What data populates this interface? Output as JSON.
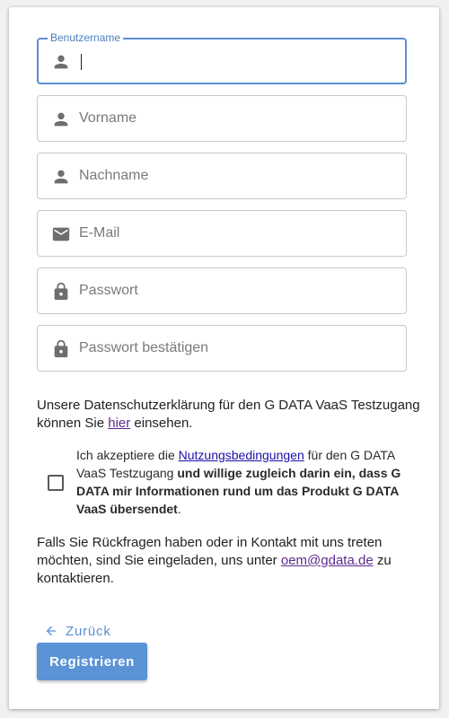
{
  "form": {
    "fields": [
      {
        "name": "username",
        "label": "Benutzername",
        "value": "",
        "placeholder": "",
        "icon": "person-icon",
        "focused": true
      },
      {
        "name": "firstname",
        "placeholder": "Vorname",
        "icon": "person-icon"
      },
      {
        "name": "lastname",
        "placeholder": "Nachname",
        "icon": "person-icon"
      },
      {
        "name": "email",
        "placeholder": "E-Mail",
        "icon": "mail-icon"
      },
      {
        "name": "password",
        "placeholder": "Passwort",
        "icon": "lock-icon"
      },
      {
        "name": "password-confirm",
        "placeholder": "Passwort bestätigen",
        "icon": "lock-icon"
      }
    ]
  },
  "privacy": {
    "text_before": "Unsere Datenschutzerklärung für den G DATA VaaS Testzugang können Sie ",
    "link": "hier",
    "text_after": " einsehen."
  },
  "consent": {
    "checked": false,
    "text_before": "Ich akzeptiere die ",
    "link": "Nutzungsbedingungen",
    "text_mid": " für den G DATA VaaS Testzugang ",
    "text_bold": "und willige zugleich darin ein, dass G DATA mir Informationen rund um das Produkt G DATA VaaS übersendet",
    "text_end": "."
  },
  "contact": {
    "text_before": "Falls Sie Rückfragen haben oder in Kontakt mit uns treten möchten, sind Sie eingeladen, uns unter ",
    "email": "oem@gdata.de",
    "text_after": " zu kontaktieren."
  },
  "actions": {
    "back_label": "Zurück",
    "submit_label": "Registrieren"
  },
  "colors": {
    "accent": "#5a93d6",
    "focus_border": "#5b8fd0",
    "link": "#1a0dab",
    "link_visited": "#5d2a8c"
  }
}
